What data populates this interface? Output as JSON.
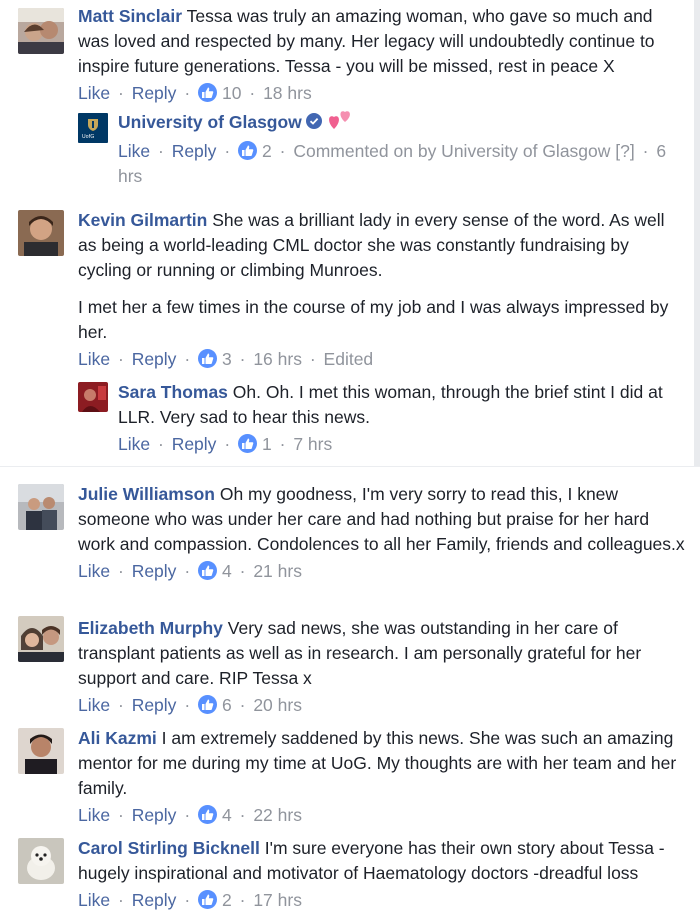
{
  "actions": {
    "like": "Like",
    "reply": "Reply",
    "sep": "·"
  },
  "comments": [
    {
      "name": "Matt Sinclair",
      "text": "Tessa was truly an amazing woman, who gave so much and was loved and respected by many. Her legacy will undoubtedly continue to inspire future generations. Tessa - you will be missed, rest in peace X",
      "likes": "10",
      "time": "18 hrs",
      "reply": {
        "name": "University of Glasgow",
        "likes": "2",
        "note": "Commented on by University of Glasgow",
        "help": "[?]",
        "time": "6 hrs"
      }
    },
    {
      "name": "Kevin Gilmartin",
      "text": "She was a brilliant lady in every sense of the word. As well as being a world-leading CML doctor she was constantly fundraising by cycling or running or climbing Munroes.",
      "text2": "I met her a few times in the course of my job and I was always impressed by her.",
      "likes": "3",
      "time": "16 hrs",
      "edited": "Edited",
      "reply": {
        "name": "Sara Thomas",
        "text": "Oh. Oh. I met this woman, through the brief stint I did at LLR. Very sad to hear this news.",
        "likes": "1",
        "time": "7 hrs"
      }
    },
    {
      "name": "Julie Williamson",
      "text": "Oh my goodness, I'm very sorry to read this, I knew someone who was under her care and had nothing but praise for her hard work and compassion. Condolences to all her Family, friends and colleagues.x",
      "likes": "4",
      "time": "21 hrs"
    },
    {
      "name": "Elizabeth Murphy",
      "text": "Very sad news, she was outstanding in her care of transplant patients as well as in research. I am personally grateful for her support and care. RIP Tessa x",
      "likes": "6",
      "time": "20 hrs"
    },
    {
      "name": "Ali Kazmi",
      "text": "I am extremely saddened by this news. She was such an amazing mentor for me during my time at UoG. My thoughts are with her team and her family.",
      "likes": "4",
      "time": "22 hrs"
    },
    {
      "name": "Carol Stirling Bicknell",
      "text": "I'm sure everyone has their own story about Tessa -hugely inspirational and motivator of Haematology doctors -dreadful loss",
      "likes": "2",
      "time": "17 hrs"
    }
  ],
  "colors": {
    "name": "#365899",
    "link": "#4b67a1",
    "meta": "#90949c",
    "like_badge": "#5890ff"
  },
  "icons": [
    "like-thumb-icon",
    "verified-badge-icon",
    "hearts-emoji-icon",
    "university-logo-icon"
  ]
}
